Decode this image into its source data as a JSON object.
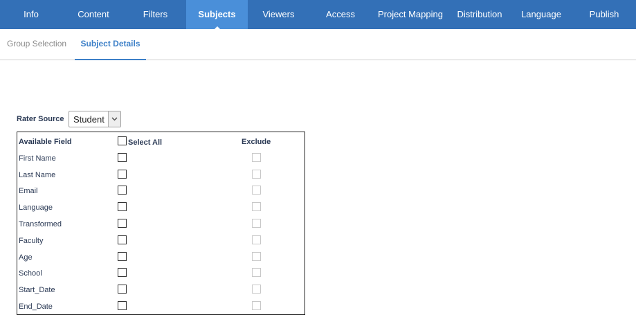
{
  "topnav": {
    "tabs": [
      {
        "label": "Info"
      },
      {
        "label": "Content"
      },
      {
        "label": "Filters"
      },
      {
        "label": "Subjects",
        "active": true
      },
      {
        "label": "Viewers"
      },
      {
        "label": "Access"
      },
      {
        "label": "Project Mapping"
      },
      {
        "label": "Distribution"
      },
      {
        "label": "Language"
      },
      {
        "label": "Publish"
      }
    ]
  },
  "subnav": {
    "tabs": [
      {
        "label": "Group Selection"
      },
      {
        "label": "Subject Details",
        "active": true
      }
    ]
  },
  "rater": {
    "label": "Rater Source",
    "selected": "Student",
    "arrow_icon": "chevron-down-icon"
  },
  "fields": {
    "header_field": "Available Field",
    "header_select_all": "Select All",
    "header_exclude": "Exclude",
    "rows": [
      {
        "label": "First Name"
      },
      {
        "label": "Last Name"
      },
      {
        "label": "Email"
      },
      {
        "label": "Language"
      },
      {
        "label": "Transformed"
      },
      {
        "label": "Faculty"
      },
      {
        "label": "Age"
      },
      {
        "label": "School"
      },
      {
        "label": "Start_Date"
      },
      {
        "label": "End_Date"
      }
    ]
  },
  "colors": {
    "nav_bg": "#3370b7",
    "nav_active_bg": "#4a8fd9",
    "subtab_active": "#3d80c8",
    "label_text": "#2b3a55"
  }
}
